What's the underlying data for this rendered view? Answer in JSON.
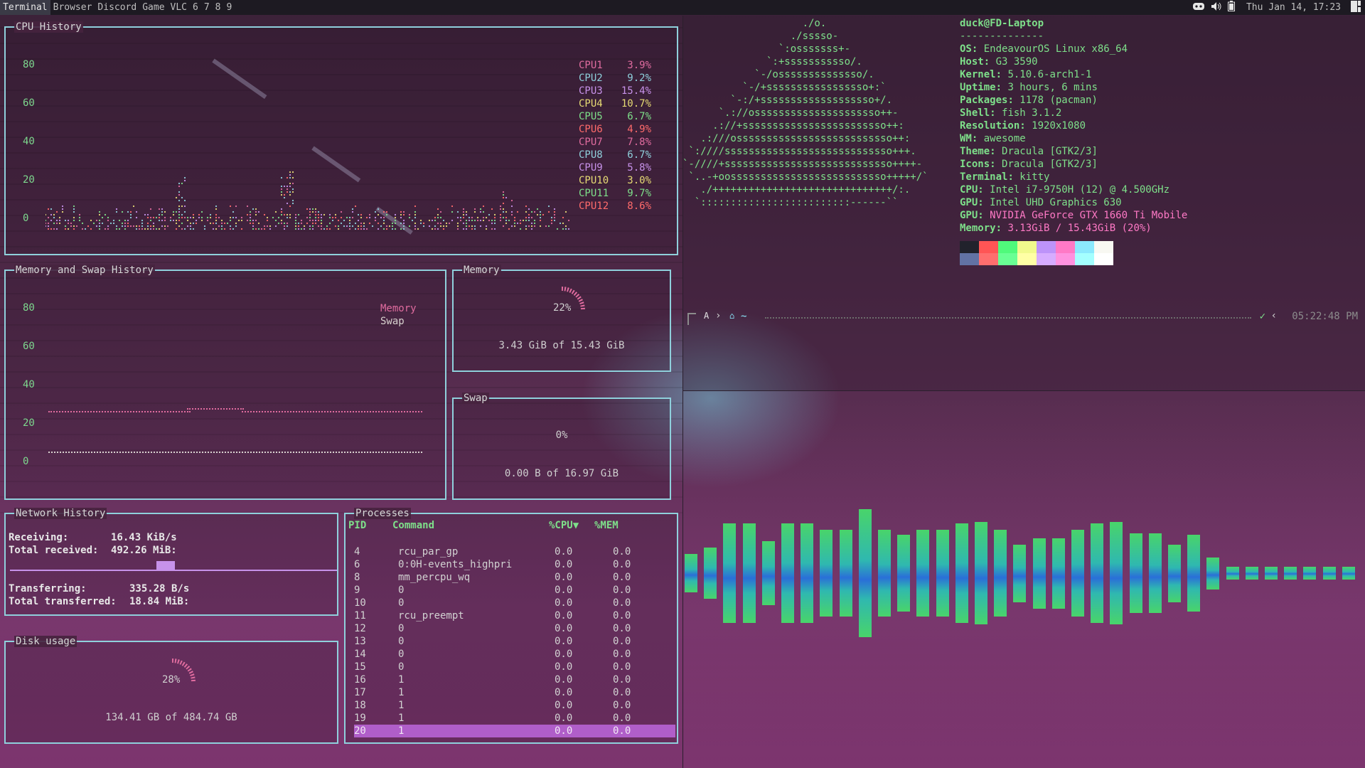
{
  "topbar": {
    "tags": [
      "Terminal",
      "Browser",
      "Discord",
      "Game",
      "VLC",
      "6",
      "7",
      "8",
      "9"
    ],
    "active_tag": "Terminal",
    "datetime": "Thu Jan 14, 17:23"
  },
  "cpu": {
    "title": "CPU History",
    "y_ticks": [
      "80",
      "60",
      "40",
      "20",
      "0"
    ],
    "legend": [
      {
        "name": "CPU1",
        "value": "3.9%",
        "color": "#e06c9f"
      },
      {
        "name": "CPU2",
        "value": "9.2%",
        "color": "#8fd0dc"
      },
      {
        "name": "CPU3",
        "value": "15.4%",
        "color": "#c792ea"
      },
      {
        "name": "CPU4",
        "value": "10.7%",
        "color": "#e6db74"
      },
      {
        "name": "CPU5",
        "value": "6.7%",
        "color": "#7ee08a"
      },
      {
        "name": "CPU6",
        "value": "4.9%",
        "color": "#ff6b6b"
      },
      {
        "name": "CPU7",
        "value": "7.8%",
        "color": "#e06c9f"
      },
      {
        "name": "CPU8",
        "value": "6.7%",
        "color": "#8fd0dc"
      },
      {
        "name": "CPU9",
        "value": "5.8%",
        "color": "#c792ea"
      },
      {
        "name": "CPU10",
        "value": "3.0%",
        "color": "#e6db74"
      },
      {
        "name": "CPU11",
        "value": "9.7%",
        "color": "#7ee08a"
      },
      {
        "name": "CPU12",
        "value": "8.6%",
        "color": "#ff6b6b"
      }
    ]
  },
  "mem_history": {
    "title": "Memory and Swap History",
    "y_ticks": [
      "80",
      "60",
      "40",
      "20",
      "0"
    ],
    "legend": [
      {
        "name": "Memory",
        "color": "#e06c9f"
      },
      {
        "name": "Swap",
        "color": "#d8d2cf"
      }
    ]
  },
  "memory": {
    "title": "Memory",
    "percent_label": "22%",
    "detail": "3.43 GiB of 15.43 GiB"
  },
  "swap": {
    "title": "Swap",
    "percent_label": "0%",
    "detail": "0.00 B of 16.97 GiB"
  },
  "network": {
    "title": "Network History",
    "receiving_label": "Receiving:",
    "receiving_value": "16.43 KiB/s",
    "total_received_label": "Total received:",
    "total_received_value": "492.26 MiB:",
    "transferring_label": "Transferring:",
    "transferring_value": "335.28  B/s",
    "total_transferred_label": "Total transferred:",
    "total_transferred_value": "18.84 MiB:"
  },
  "disk": {
    "title": "Disk usage",
    "percent_label": "28%",
    "detail": "134.41 GB of 484.74 GB"
  },
  "processes": {
    "title": "Processes",
    "headers": [
      "PID",
      "Command",
      "%CPU▼",
      "%MEM"
    ],
    "rows": [
      [
        "4",
        "rcu_par_gp",
        "0.0",
        "0.0"
      ],
      [
        "6",
        "0:0H-events_highpri",
        "0.0",
        "0.0"
      ],
      [
        "8",
        "mm_percpu_wq",
        "0.0",
        "0.0"
      ],
      [
        "9",
        "0",
        "0.0",
        "0.0"
      ],
      [
        "10",
        "0",
        "0.0",
        "0.0"
      ],
      [
        "11",
        "rcu_preempt",
        "0.0",
        "0.0"
      ],
      [
        "12",
        "0",
        "0.0",
        "0.0"
      ],
      [
        "13",
        "0",
        "0.0",
        "0.0"
      ],
      [
        "14",
        "0",
        "0.0",
        "0.0"
      ],
      [
        "15",
        "0",
        "0.0",
        "0.0"
      ],
      [
        "16",
        "1",
        "0.0",
        "0.0"
      ],
      [
        "17",
        "1",
        "0.0",
        "0.0"
      ],
      [
        "18",
        "1",
        "0.0",
        "0.0"
      ],
      [
        "19",
        "1",
        "0.0",
        "0.0"
      ],
      [
        "20",
        "1",
        "0.0",
        "0.0"
      ]
    ],
    "selected_pid": "20"
  },
  "neofetch": {
    "ascii": [
      "                    ./o.",
      "                  ./sssso-",
      "                `:osssssss+-",
      "              `:+sssssssssso/.",
      "            `-/ossssssssssssso/.",
      "          `-/+sssssssssssssssso+:`",
      "        `-:/+sssssssssssssssssso+/.",
      "      `.://osssssssssssssssssssso++-",
      "     .://+ssssssssssssssssssssssso++:",
      "   .:///ossssssssssssssssssssssssso++:",
      " `:////ssssssssssssssssssssssssssso+++.",
      "`-////+ssssssssssssssssssssssssssso++++-",
      " `..-+oossssssssssssssssssssssssso+++++/`",
      "   ./++++++++++++++++++++++++++++++/:.",
      "  `:::::::::::::::::::::::::------``"
    ],
    "user_host": "duck@FD-Laptop",
    "separator": "--------------",
    "fields": [
      {
        "k": "OS",
        "v": "EndeavourOS Linux x86_64"
      },
      {
        "k": "Host",
        "v": "G3 3590"
      },
      {
        "k": "Kernel",
        "v": "5.10.6-arch1-1"
      },
      {
        "k": "Uptime",
        "v": "3 hours, 6 mins"
      },
      {
        "k": "Packages",
        "v": "1178 (pacman)"
      },
      {
        "k": "Shell",
        "v": "fish 3.1.2"
      },
      {
        "k": "Resolution",
        "v": "1920x1080"
      },
      {
        "k": "WM",
        "v": "awesome"
      },
      {
        "k": "Theme",
        "v": "Dracula [GTK2/3]"
      },
      {
        "k": "Icons",
        "v": "Dracula [GTK2/3]"
      },
      {
        "k": "Terminal",
        "v": "kitty"
      },
      {
        "k": "CPU",
        "v": "Intel i7-9750H (12) @ 4.500GHz"
      },
      {
        "k": "GPU",
        "v": "Intel UHD Graphics 630"
      },
      {
        "k": "GPU",
        "v": "NVIDIA GeForce GTX 1660 Ti Mobile"
      },
      {
        "k": "Memory",
        "v": "3.13GiB / 15.43GiB (20%)"
      }
    ],
    "memory_color": "#ff79c6",
    "gpu2_color": "#ff79c6",
    "swatches_top": [
      "#21222c",
      "#ff5555",
      "#50fa7b",
      "#f1fa8c",
      "#bd93f9",
      "#ff79c6",
      "#8be9fd",
      "#f8f8f2"
    ],
    "swatches_bottom": [
      "#6272a4",
      "#ff6e6e",
      "#69ff94",
      "#ffffa5",
      "#d6acff",
      "#ff92df",
      "#a4ffff",
      "#ffffff"
    ]
  },
  "prompt": {
    "arch_glyph": "A",
    "path": "~",
    "status": "✓",
    "time": "05:22:48 PM"
  },
  "visualizer": {
    "levels": [
      0.3,
      0.4,
      0.78,
      0.78,
      0.5,
      0.78,
      0.78,
      0.68,
      0.68,
      1.0,
      0.68,
      0.6,
      0.68,
      0.68,
      0.78,
      0.8,
      0.68,
      0.45,
      0.55,
      0.55,
      0.68,
      0.78,
      0.8,
      0.62,
      0.62,
      0.45,
      0.6,
      0.25,
      0.1,
      0.1,
      0.1,
      0.1,
      0.1,
      0.1,
      0.1
    ]
  }
}
